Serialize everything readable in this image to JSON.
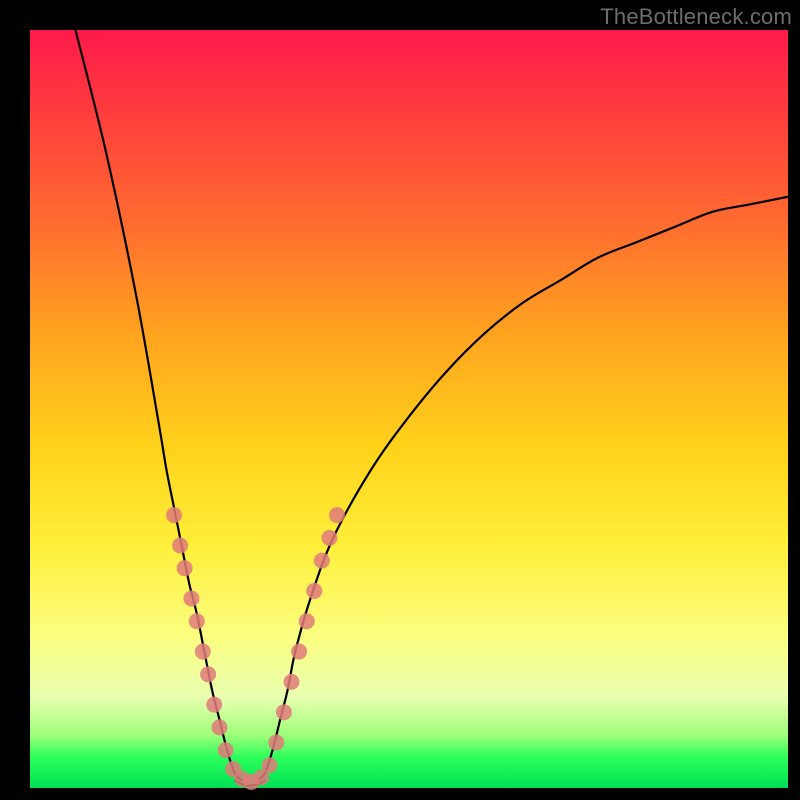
{
  "watermark": "TheBottleneck.com",
  "colors": {
    "frame": "#000000",
    "dot": "#e07a7a",
    "curve": "#000000",
    "gradient_top": "#ff1a4b",
    "gradient_bottom": "#00e055"
  },
  "chart_data": {
    "type": "line",
    "title": "",
    "xlabel": "",
    "ylabel": "",
    "xlim": [
      0,
      100
    ],
    "ylim": [
      0,
      100
    ],
    "grid": false,
    "legend": false,
    "description": "Bottleneck curve with V-shaped minimum; gradient background from red (high bottleneck) at top to green (low bottleneck) at bottom.",
    "series": [
      {
        "name": "bottleneck-curve-left",
        "x": [
          6,
          10,
          14,
          17,
          18,
          19,
          20,
          21,
          22,
          23,
          24,
          25,
          26,
          27,
          28
        ],
        "y": [
          100,
          84,
          65,
          48,
          42,
          37,
          32,
          27,
          23,
          18,
          13,
          9,
          5,
          2,
          1
        ]
      },
      {
        "name": "bottleneck-curve-right",
        "x": [
          30,
          31,
          32,
          33,
          34,
          35,
          37,
          40,
          45,
          50,
          55,
          60,
          65,
          70,
          75,
          80,
          85,
          90,
          95,
          100
        ],
        "y": [
          1,
          2,
          5,
          9,
          13,
          18,
          25,
          33,
          42,
          49,
          55,
          60,
          64,
          67,
          70,
          72,
          74,
          76,
          77,
          78
        ]
      },
      {
        "name": "bottleneck-curve-bottom",
        "x": [
          27,
          28,
          29,
          30,
          31
        ],
        "y": [
          1,
          0.5,
          0.3,
          0.5,
          1
        ]
      }
    ],
    "points": [
      {
        "x": 19.0,
        "y": 36
      },
      {
        "x": 19.8,
        "y": 32
      },
      {
        "x": 20.4,
        "y": 29
      },
      {
        "x": 21.3,
        "y": 25
      },
      {
        "x": 22.0,
        "y": 22
      },
      {
        "x": 22.8,
        "y": 18
      },
      {
        "x": 23.5,
        "y": 15
      },
      {
        "x": 24.3,
        "y": 11
      },
      {
        "x": 25.0,
        "y": 8
      },
      {
        "x": 25.8,
        "y": 5
      },
      {
        "x": 26.8,
        "y": 2.5
      },
      {
        "x": 28.0,
        "y": 1.2
      },
      {
        "x": 29.2,
        "y": 0.8
      },
      {
        "x": 30.5,
        "y": 1.4
      },
      {
        "x": 31.6,
        "y": 3
      },
      {
        "x": 32.5,
        "y": 6
      },
      {
        "x": 33.5,
        "y": 10
      },
      {
        "x": 34.5,
        "y": 14
      },
      {
        "x": 35.5,
        "y": 18
      },
      {
        "x": 36.5,
        "y": 22
      },
      {
        "x": 37.5,
        "y": 26
      },
      {
        "x": 38.5,
        "y": 30
      },
      {
        "x": 39.5,
        "y": 33
      },
      {
        "x": 40.5,
        "y": 36
      }
    ],
    "dot_radius_px": 8
  }
}
